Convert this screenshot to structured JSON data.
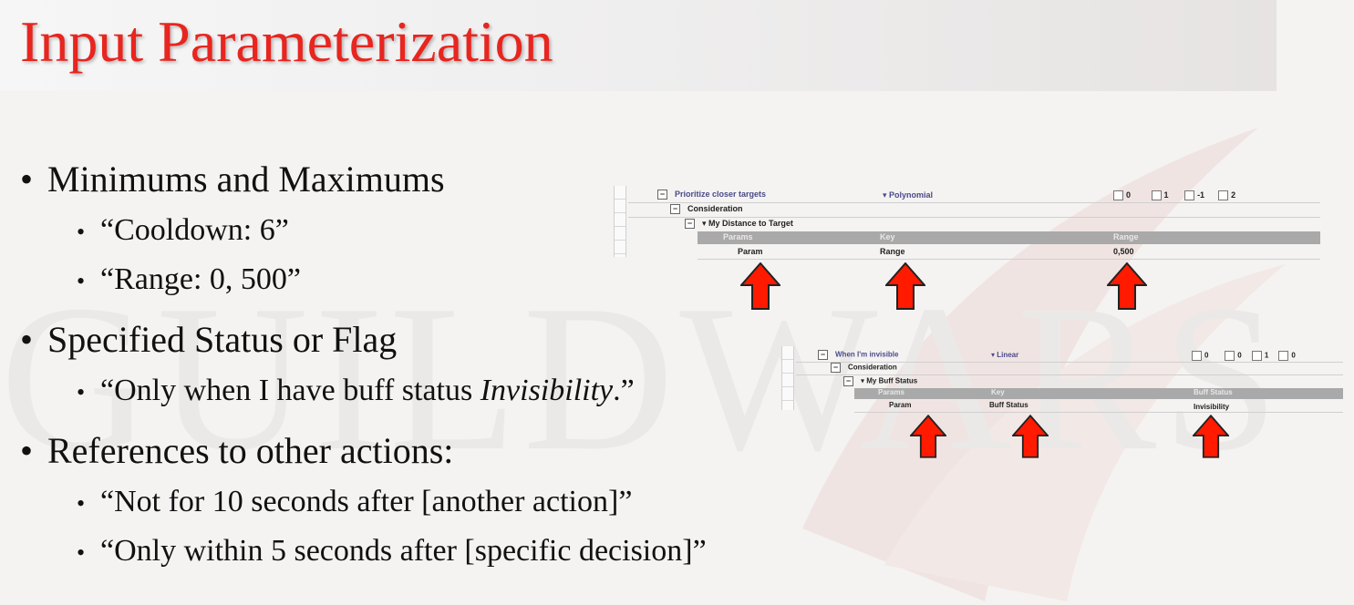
{
  "slide": {
    "title": "Input Parameterization",
    "watermark": "GUILDWARS",
    "bullets": [
      {
        "text": "Minimums and Maximums",
        "children": [
          "“Cooldown: 6”",
          "“Range: 0, 500”"
        ]
      },
      {
        "text": "Specified Status or Flag",
        "children_parts": [
          {
            "pre": "“Only when I have buff status ",
            "em": "Invisibility",
            "post": ".”"
          }
        ]
      },
      {
        "text": "References to other actions:",
        "children": [
          "“Not for 10 seconds after [another action]”",
          "“Only within 5 seconds after [specific decision]”"
        ]
      }
    ],
    "bullet_char": "•"
  },
  "screenshot1": {
    "row1_label": "Prioritize closer targets",
    "row1_type": "▾ Polynomial",
    "row1_params": [
      "0",
      "1",
      "-1",
      "2"
    ],
    "row2_label": "Consideration",
    "row3_label": "▾ My Distance to Target",
    "header": [
      "Params",
      "Key",
      "Range"
    ],
    "values": [
      "Param",
      "Range",
      "0,500"
    ]
  },
  "screenshot2": {
    "row1_label": "When I'm invisible",
    "row1_type": "▾ Linear",
    "row1_params": [
      "0",
      "0",
      "1",
      "0"
    ],
    "row2_label": "Consideration",
    "row3_label": "▾ My Buff Status",
    "header": [
      "Params",
      "Key",
      "Buff Status"
    ],
    "values": [
      "Param",
      "Buff Status",
      "Invisibility"
    ]
  },
  "colors": {
    "title": "#e8251f",
    "arrow": "#ff1a00",
    "text": "#111111"
  },
  "icons": {
    "arrow": "up-arrow-icon",
    "expander": "minus-expander-icon"
  }
}
